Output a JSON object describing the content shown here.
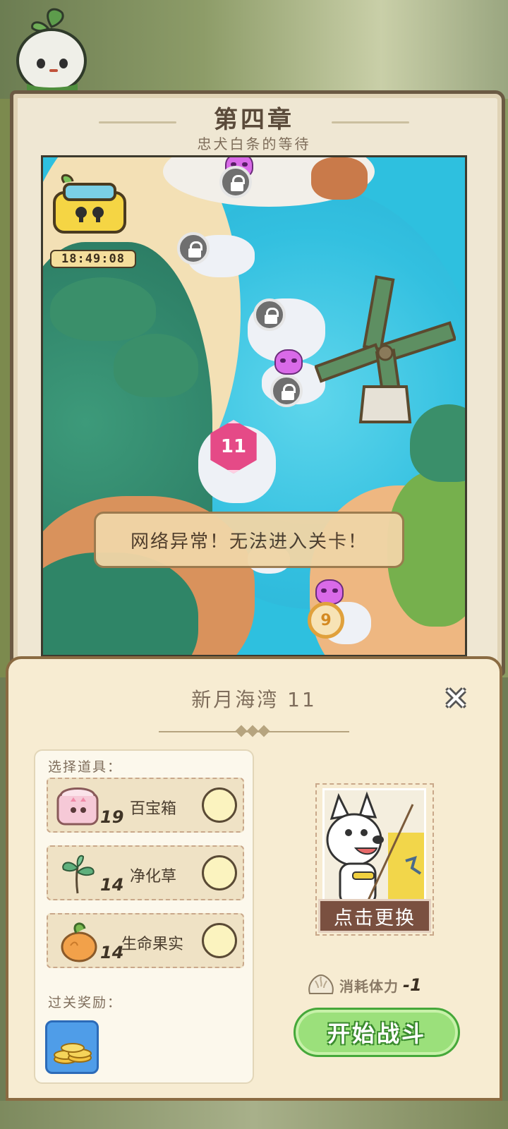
{
  "chapter": {
    "title": "第四章",
    "subtitle": "忠犬白条的等待"
  },
  "map": {
    "timer": "18:49:08",
    "current_level": "11",
    "next_level": "9",
    "toast": "网络异常！无法进入关卡！"
  },
  "stage_panel": {
    "stage_title": "新月海湾 11",
    "select_items_label": "选择道具：",
    "items": [
      {
        "name": "百宝箱",
        "count": "19",
        "icon": "treasure-chest-icon"
      },
      {
        "name": "净化草",
        "count": "14",
        "icon": "herb-icon"
      },
      {
        "name": "生命果实",
        "count": "14",
        "icon": "life-fruit-icon"
      }
    ],
    "reward_label": "过关奖励：",
    "reward_icon": "coins-icon",
    "change_label": "点击更换",
    "cost_label": "消耗体力",
    "cost_value": "-1",
    "start_label": "开始战斗"
  },
  "colors": {
    "accent_pink": "#e54a87",
    "start_green": "#9be07b",
    "parchment": "#f7ecd2"
  }
}
